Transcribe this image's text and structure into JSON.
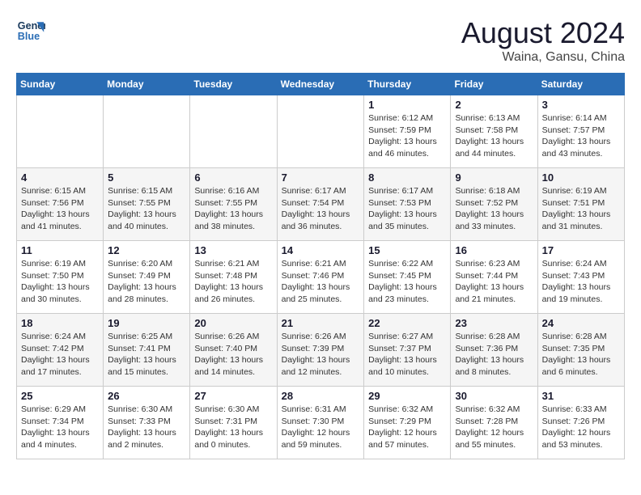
{
  "header": {
    "logo_line1": "General",
    "logo_line2": "Blue",
    "title": "August 2024",
    "subtitle": "Waina, Gansu, China"
  },
  "columns": [
    "Sunday",
    "Monday",
    "Tuesday",
    "Wednesday",
    "Thursday",
    "Friday",
    "Saturday"
  ],
  "weeks": [
    [
      {
        "day": "",
        "info": ""
      },
      {
        "day": "",
        "info": ""
      },
      {
        "day": "",
        "info": ""
      },
      {
        "day": "",
        "info": ""
      },
      {
        "day": "1",
        "info": "Sunrise: 6:12 AM\nSunset: 7:59 PM\nDaylight: 13 hours\nand 46 minutes."
      },
      {
        "day": "2",
        "info": "Sunrise: 6:13 AM\nSunset: 7:58 PM\nDaylight: 13 hours\nand 44 minutes."
      },
      {
        "day": "3",
        "info": "Sunrise: 6:14 AM\nSunset: 7:57 PM\nDaylight: 13 hours\nand 43 minutes."
      }
    ],
    [
      {
        "day": "4",
        "info": "Sunrise: 6:15 AM\nSunset: 7:56 PM\nDaylight: 13 hours\nand 41 minutes."
      },
      {
        "day": "5",
        "info": "Sunrise: 6:15 AM\nSunset: 7:55 PM\nDaylight: 13 hours\nand 40 minutes."
      },
      {
        "day": "6",
        "info": "Sunrise: 6:16 AM\nSunset: 7:55 PM\nDaylight: 13 hours\nand 38 minutes."
      },
      {
        "day": "7",
        "info": "Sunrise: 6:17 AM\nSunset: 7:54 PM\nDaylight: 13 hours\nand 36 minutes."
      },
      {
        "day": "8",
        "info": "Sunrise: 6:17 AM\nSunset: 7:53 PM\nDaylight: 13 hours\nand 35 minutes."
      },
      {
        "day": "9",
        "info": "Sunrise: 6:18 AM\nSunset: 7:52 PM\nDaylight: 13 hours\nand 33 minutes."
      },
      {
        "day": "10",
        "info": "Sunrise: 6:19 AM\nSunset: 7:51 PM\nDaylight: 13 hours\nand 31 minutes."
      }
    ],
    [
      {
        "day": "11",
        "info": "Sunrise: 6:19 AM\nSunset: 7:50 PM\nDaylight: 13 hours\nand 30 minutes."
      },
      {
        "day": "12",
        "info": "Sunrise: 6:20 AM\nSunset: 7:49 PM\nDaylight: 13 hours\nand 28 minutes."
      },
      {
        "day": "13",
        "info": "Sunrise: 6:21 AM\nSunset: 7:48 PM\nDaylight: 13 hours\nand 26 minutes."
      },
      {
        "day": "14",
        "info": "Sunrise: 6:21 AM\nSunset: 7:46 PM\nDaylight: 13 hours\nand 25 minutes."
      },
      {
        "day": "15",
        "info": "Sunrise: 6:22 AM\nSunset: 7:45 PM\nDaylight: 13 hours\nand 23 minutes."
      },
      {
        "day": "16",
        "info": "Sunrise: 6:23 AM\nSunset: 7:44 PM\nDaylight: 13 hours\nand 21 minutes."
      },
      {
        "day": "17",
        "info": "Sunrise: 6:24 AM\nSunset: 7:43 PM\nDaylight: 13 hours\nand 19 minutes."
      }
    ],
    [
      {
        "day": "18",
        "info": "Sunrise: 6:24 AM\nSunset: 7:42 PM\nDaylight: 13 hours\nand 17 minutes."
      },
      {
        "day": "19",
        "info": "Sunrise: 6:25 AM\nSunset: 7:41 PM\nDaylight: 13 hours\nand 15 minutes."
      },
      {
        "day": "20",
        "info": "Sunrise: 6:26 AM\nSunset: 7:40 PM\nDaylight: 13 hours\nand 14 minutes."
      },
      {
        "day": "21",
        "info": "Sunrise: 6:26 AM\nSunset: 7:39 PM\nDaylight: 13 hours\nand 12 minutes."
      },
      {
        "day": "22",
        "info": "Sunrise: 6:27 AM\nSunset: 7:37 PM\nDaylight: 13 hours\nand 10 minutes."
      },
      {
        "day": "23",
        "info": "Sunrise: 6:28 AM\nSunset: 7:36 PM\nDaylight: 13 hours\nand 8 minutes."
      },
      {
        "day": "24",
        "info": "Sunrise: 6:28 AM\nSunset: 7:35 PM\nDaylight: 13 hours\nand 6 minutes."
      }
    ],
    [
      {
        "day": "25",
        "info": "Sunrise: 6:29 AM\nSunset: 7:34 PM\nDaylight: 13 hours\nand 4 minutes."
      },
      {
        "day": "26",
        "info": "Sunrise: 6:30 AM\nSunset: 7:33 PM\nDaylight: 13 hours\nand 2 minutes."
      },
      {
        "day": "27",
        "info": "Sunrise: 6:30 AM\nSunset: 7:31 PM\nDaylight: 13 hours\nand 0 minutes."
      },
      {
        "day": "28",
        "info": "Sunrise: 6:31 AM\nSunset: 7:30 PM\nDaylight: 12 hours\nand 59 minutes."
      },
      {
        "day": "29",
        "info": "Sunrise: 6:32 AM\nSunset: 7:29 PM\nDaylight: 12 hours\nand 57 minutes."
      },
      {
        "day": "30",
        "info": "Sunrise: 6:32 AM\nSunset: 7:28 PM\nDaylight: 12 hours\nand 55 minutes."
      },
      {
        "day": "31",
        "info": "Sunrise: 6:33 AM\nSunset: 7:26 PM\nDaylight: 12 hours\nand 53 minutes."
      }
    ]
  ]
}
